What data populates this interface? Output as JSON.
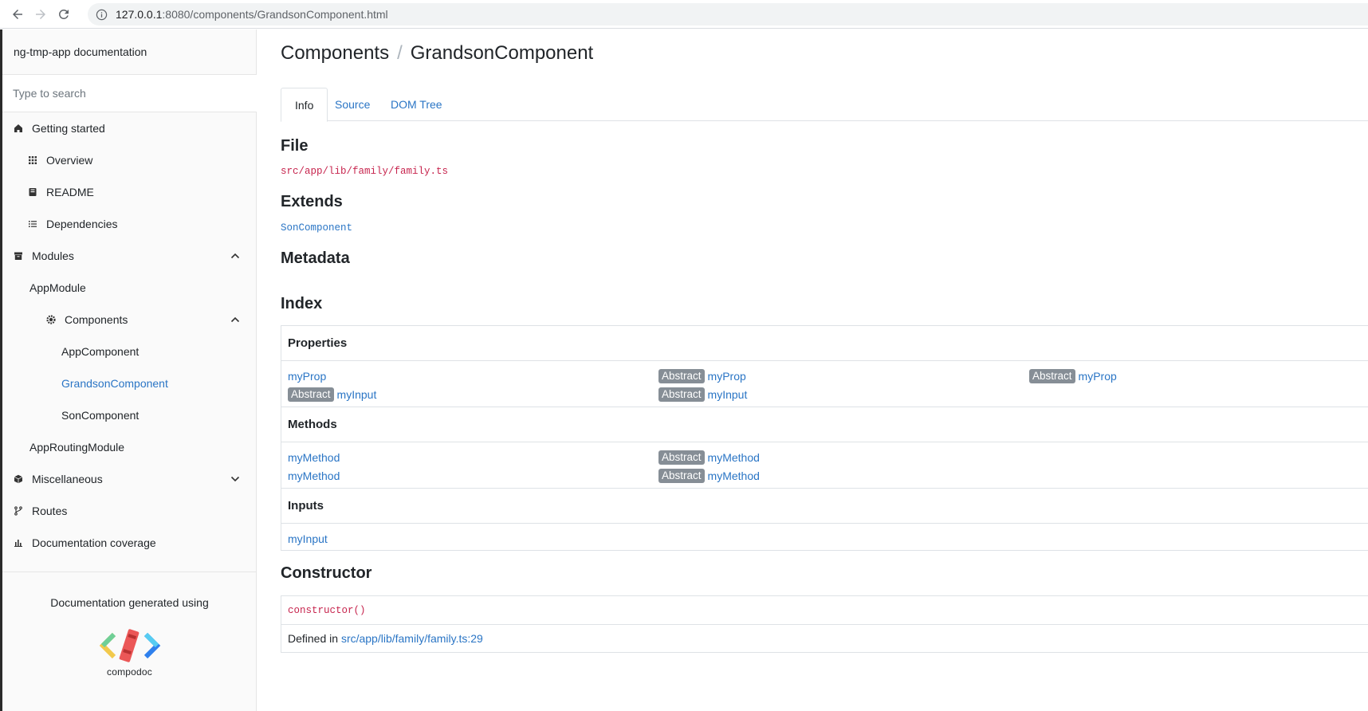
{
  "browser": {
    "url_host": "127.0.0.1",
    "url_rest": ":8080/components/GrandsonComponent.html"
  },
  "sidebar": {
    "title": "ng-tmp-app documentation",
    "search_placeholder": "Type to search",
    "items": [
      {
        "label": "Getting started"
      },
      {
        "label": "Overview"
      },
      {
        "label": "README"
      },
      {
        "label": "Dependencies"
      },
      {
        "label": "Modules"
      },
      {
        "label": "AppModule"
      },
      {
        "label": "Components"
      },
      {
        "label": "AppComponent"
      },
      {
        "label": "GrandsonComponent"
      },
      {
        "label": "SonComponent"
      },
      {
        "label": "AppRoutingModule"
      },
      {
        "label": "Miscellaneous"
      },
      {
        "label": "Routes"
      },
      {
        "label": "Documentation coverage"
      }
    ],
    "footer_text": "Documentation generated using",
    "logo_text": "compodoc"
  },
  "breadcrumb": {
    "parent": "Components",
    "separator": "/",
    "current": "GrandsonComponent"
  },
  "tabs": [
    "Info",
    "Source",
    "DOM Tree"
  ],
  "sections": {
    "file_title": "File",
    "file_path": "src/app/lib/family/family.ts",
    "extends_title": "Extends",
    "extends_value": "SonComponent",
    "metadata_title": "Metadata",
    "index_title": "Index",
    "constructor_title": "Constructor"
  },
  "index": {
    "properties_title": "Properties",
    "properties": [
      {
        "abstract": false,
        "name": "myProp"
      },
      {
        "abstract": true,
        "name": "myProp"
      },
      {
        "abstract": true,
        "name": "myProp"
      },
      {
        "abstract": true,
        "name": "myInput"
      },
      {
        "abstract": true,
        "name": "myInput"
      }
    ],
    "methods_title": "Methods",
    "methods": [
      {
        "abstract": false,
        "name": "myMethod"
      },
      {
        "abstract": true,
        "name": "myMethod"
      },
      {
        "abstract": false,
        "name": "myMethod"
      },
      {
        "abstract": true,
        "name": "myMethod"
      }
    ],
    "inputs_title": "Inputs",
    "inputs": [
      {
        "abstract": false,
        "name": "myInput"
      }
    ],
    "badge_label": "Abstract"
  },
  "constructor": {
    "signature": "constructor()",
    "defined_in_label": "Defined in",
    "defined_in_link": "src/app/lib/family/family.ts:29"
  },
  "colors": {
    "link": "#2a75c5",
    "code": "#c7254e",
    "badge": "#868e96"
  }
}
